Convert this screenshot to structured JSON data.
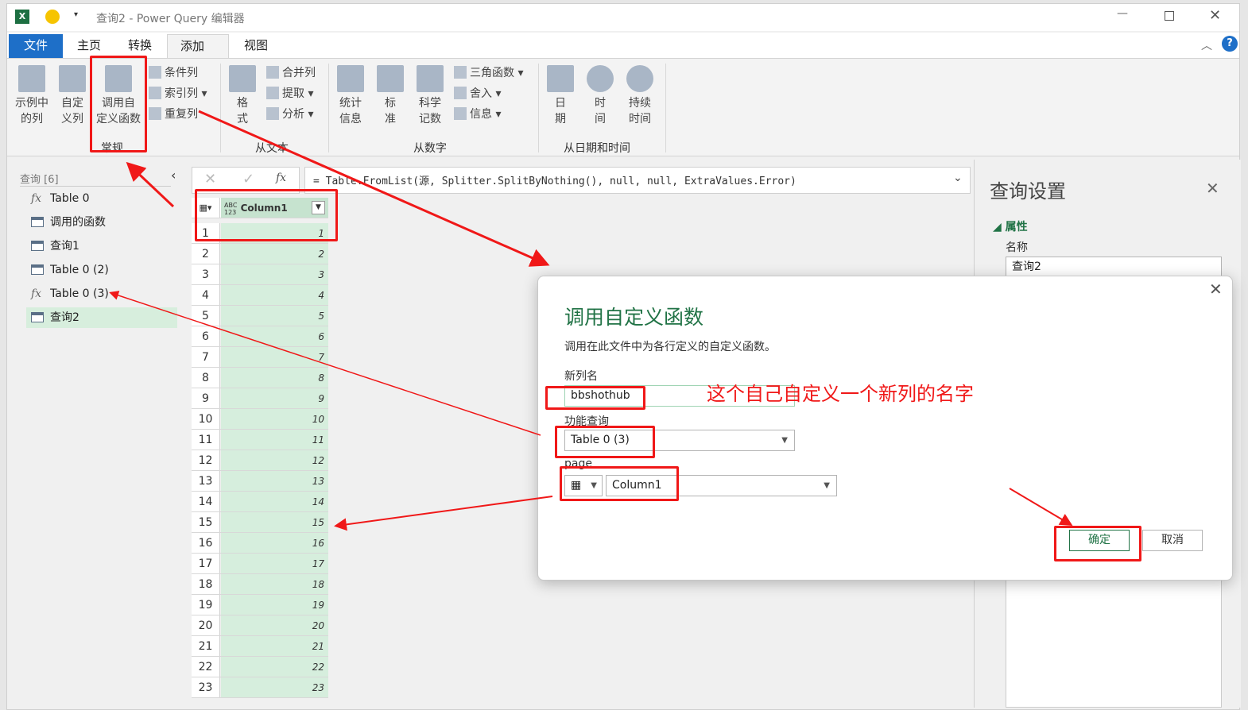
{
  "window": {
    "title": "查询2 - Power Query 编辑器",
    "help": "?"
  },
  "tabs": [
    {
      "label": "文件"
    },
    {
      "label": "主页"
    },
    {
      "label": "转换"
    },
    {
      "label": "添加列"
    },
    {
      "label": "视图"
    }
  ],
  "ribbon": {
    "general": {
      "group": "常规",
      "example": "示例中\n的列",
      "custom": "自定\n义列",
      "invoke": "调用自\n定义函数",
      "conditional": "条件列",
      "index": "索引列",
      "duplicate": "重复列"
    },
    "text": {
      "group": "从文本",
      "format": "格\n式",
      "merge": "合并列",
      "extract": "提取",
      "parse": "分析"
    },
    "number": {
      "group": "从数字",
      "stats": "统计\n信息",
      "standard": "标\n准",
      "sci": "科学\n记数",
      "trig": "三角函数",
      "round": "舍入",
      "info": "信息"
    },
    "datetime": {
      "group": "从日期和时间",
      "date": "日\n期",
      "time": "时\n间",
      "duration": "持续\n时间"
    }
  },
  "queries": {
    "header": "查询 [6]",
    "items": [
      {
        "label": "Table 0",
        "type": "fx"
      },
      {
        "label": "调用的函数",
        "type": "table"
      },
      {
        "label": "查询1",
        "type": "table"
      },
      {
        "label": "Table 0 (2)",
        "type": "table"
      },
      {
        "label": "Table 0 (3)",
        "type": "fx"
      },
      {
        "label": "查询2",
        "type": "table",
        "selected": true
      }
    ]
  },
  "formula": {
    "text": "= Table.FromList(源, Splitter.SplitByNothing(), null, null, ExtraValues.Error)",
    "fx": "fx"
  },
  "grid": {
    "type_label": "ABC\n123",
    "column": "Column1",
    "rows": [
      1,
      2,
      3,
      4,
      5,
      6,
      7,
      8,
      9,
      10,
      11,
      12,
      13,
      14,
      15,
      16,
      17,
      18,
      19,
      20,
      21,
      22,
      23
    ]
  },
  "settings": {
    "title": "查询设置",
    "section": "属性",
    "name_label": "名称",
    "name_value": "查询2"
  },
  "dialog": {
    "title": "调用自定义函数",
    "desc": "调用在此文件中为各行定义的自定义函数。",
    "newcol_label": "新列名",
    "newcol_value": "bbshothub",
    "func_label": "功能查询",
    "func_value": "Table 0 (3)",
    "param_label": "page",
    "param_value": "Column1",
    "ok": "确定",
    "cancel": "取消"
  },
  "annotation": {
    "text": "这个自己自定义一个新列的名字",
    "color": "#f01818"
  },
  "colors": {
    "accent": "#1e6fc8",
    "green": "#217346",
    "row_fill": "#d6eedd"
  }
}
